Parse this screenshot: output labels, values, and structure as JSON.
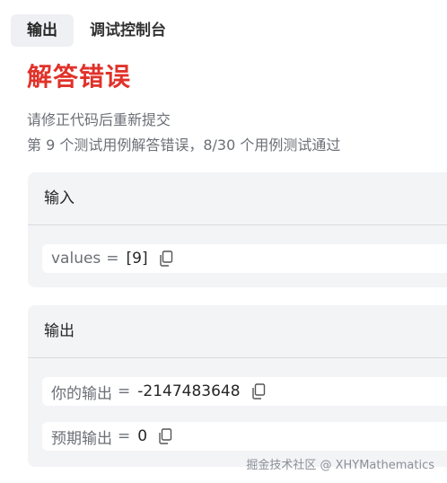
{
  "tabs": [
    {
      "label": "输出",
      "active": true
    },
    {
      "label": "调试控制台",
      "active": false
    }
  ],
  "result": {
    "title": "解答错误",
    "hint": "请修正代码后重新提交",
    "summary": "第 9 个测试用例解答错误，8/30 个用例测试通过",
    "title_color": "#e0322a"
  },
  "input_section": {
    "header": "输入",
    "fields": [
      {
        "label": "values",
        "value": "[9]"
      }
    ]
  },
  "output_section": {
    "header": "输出",
    "fields": [
      {
        "label": "你的输出",
        "value": "-2147483648"
      },
      {
        "label": "预期输出",
        "value": "0"
      }
    ]
  },
  "equals": "=",
  "watermark": "掘金技术社区 @ XHYMathematics",
  "icons": {
    "copy": "copy-icon"
  }
}
